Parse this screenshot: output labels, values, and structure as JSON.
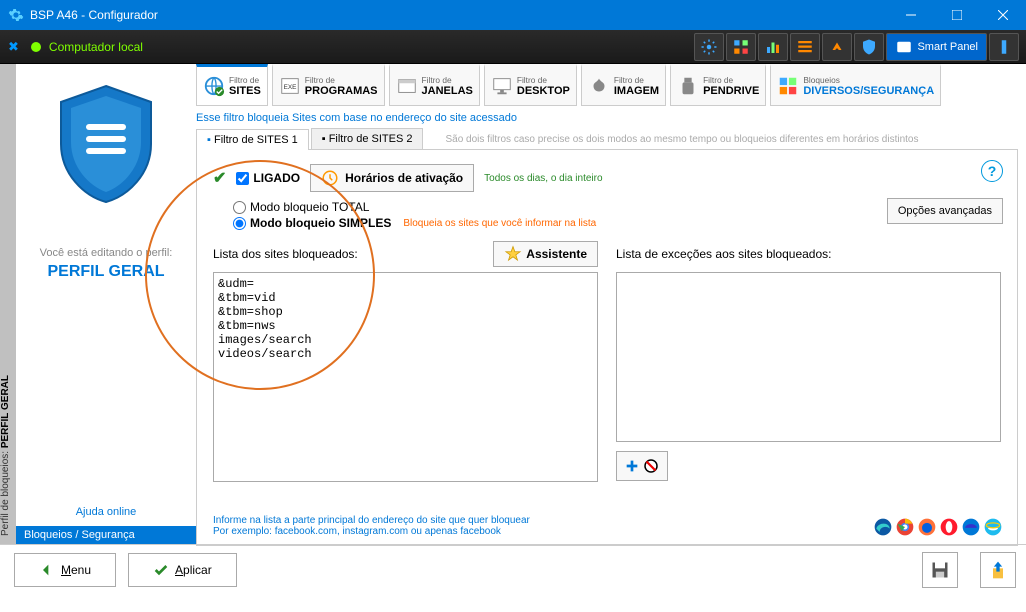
{
  "window": {
    "title": "BSP A46 - Configurador",
    "local_computer": "Computador local",
    "smart_panel": "Smart Panel"
  },
  "left": {
    "editing": "Você está editando o perfil:",
    "profile": "PERFIL GERAL",
    "help": "Ajuda online",
    "footer": "Bloqueios / Segurança",
    "rail": "Perfil de bloqueios:",
    "rail_bold": "PERFIL GERAL"
  },
  "filters": {
    "label_small": "Filtro de",
    "sites": "SITES",
    "programas": "PROGRAMAS",
    "janelas": "JANELAS",
    "desktop": "DESKTOP",
    "imagem": "IMAGEM",
    "pendrive": "PENDRIVE",
    "last_small": "Bloqueios",
    "diversos": "DIVERSOS/SEGURANÇA"
  },
  "desc": "Esse filtro bloqueia Sites com base no endereço do site acessado",
  "subtabs": {
    "t1": "Filtro de SITES 1",
    "t2": "Filtro de SITES 2",
    "hint": "São dois filtros caso precise os dois modos ao mesmo tempo ou bloqueios diferentes em horários distintos"
  },
  "config": {
    "ligado": "LIGADO",
    "schedule": "Horários de ativação",
    "schedule_hint": "Todos os dias, o dia inteiro",
    "advanced": "Opções avançadas",
    "mode_total": "Modo bloqueio TOTAL",
    "mode_simple": "Modo bloqueio SIMPLES",
    "simple_hint": "Bloqueia os sites que você informar na lista",
    "blocked_label": "Lista dos sites bloqueados:",
    "assistant": "Assistente",
    "exceptions_label": "Lista de exceções aos sites bloqueados:",
    "blocked_list": "&udm=\n&tbm=vid\n&tbm=shop\n&tbm=nws\nimages/search\nvideos/search",
    "exceptions_list": "",
    "info1": "Informe na lista a parte principal do endereço do site que quer bloquear",
    "info2": "Por exemplo: facebook.com, instagram.com ou apenas facebook"
  },
  "actions": {
    "menu": "Menu",
    "apply": "Aplicar",
    "menu_key": "M",
    "apply_key": "A"
  }
}
